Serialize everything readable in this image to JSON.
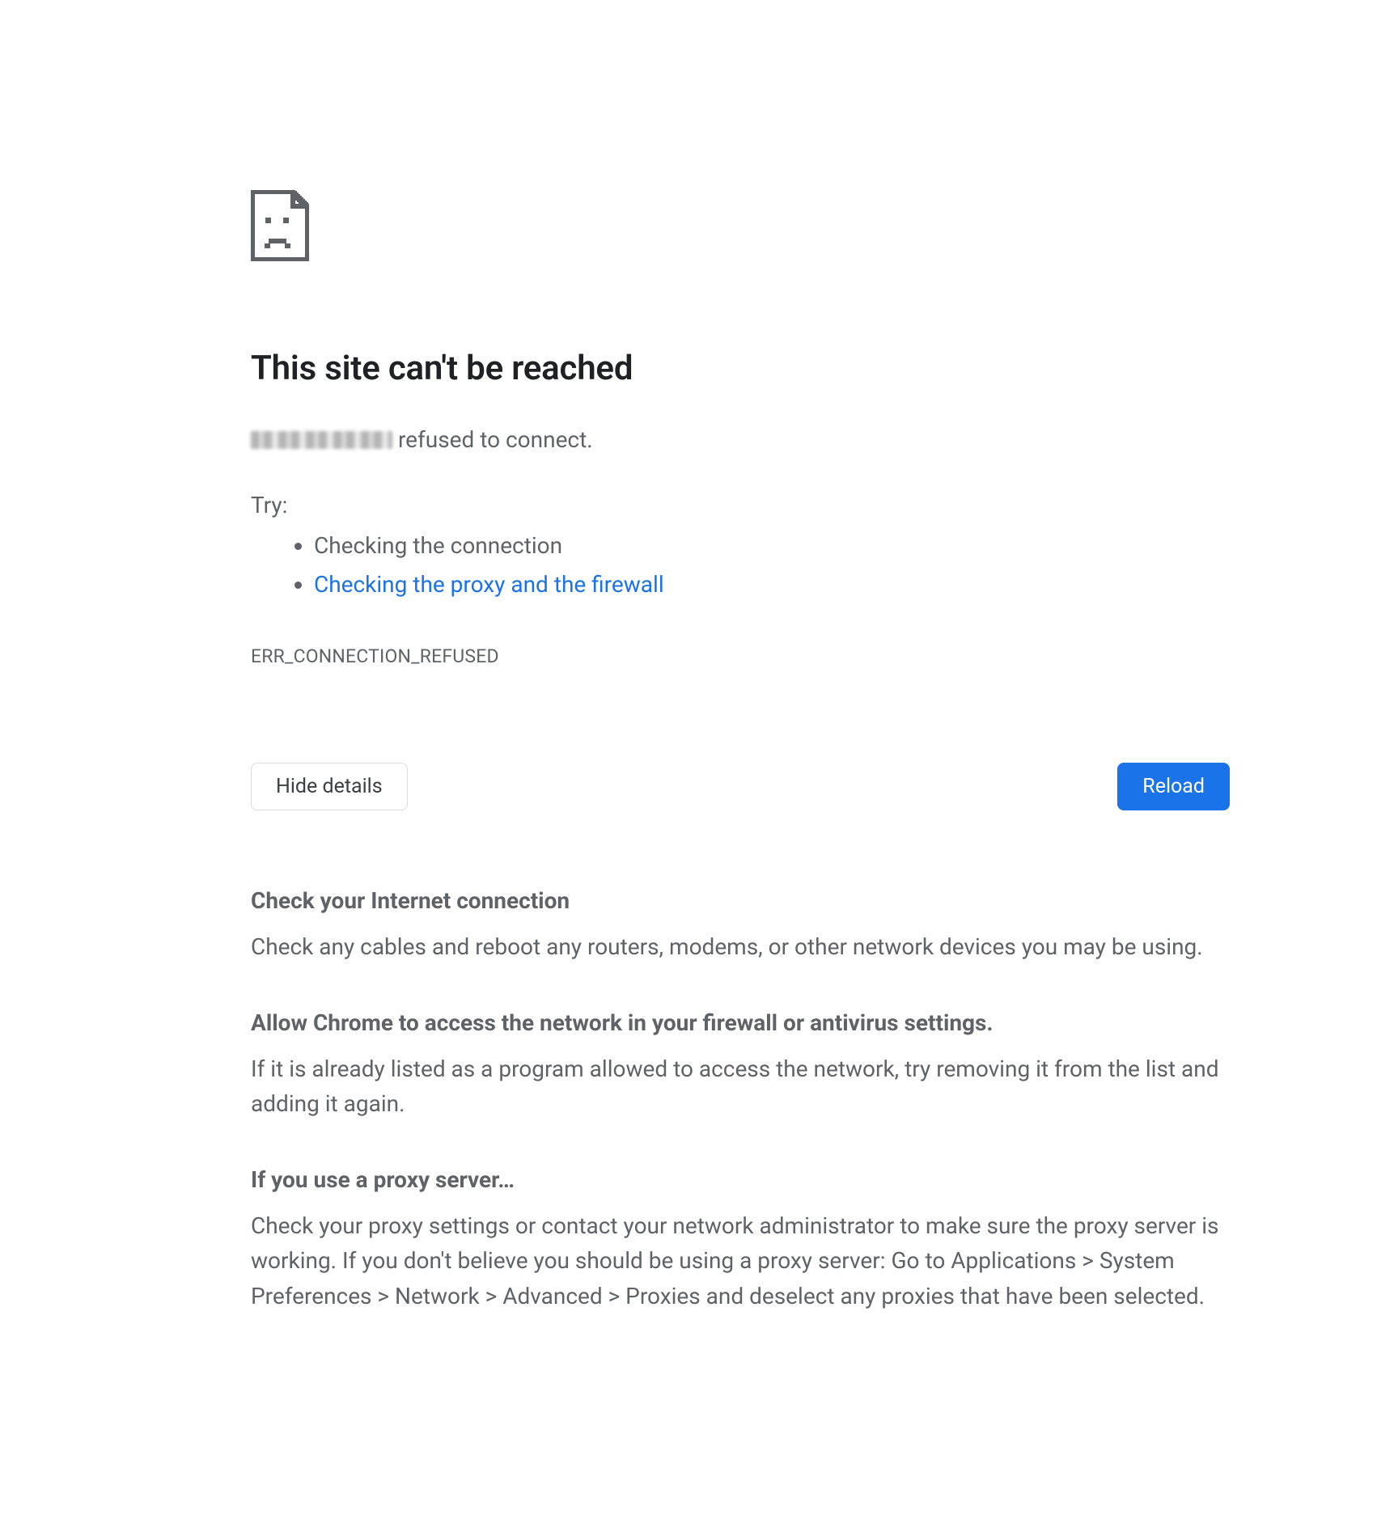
{
  "title": "This site can't be reached",
  "summary_suffix": " refused to connect.",
  "try_label": "Try:",
  "try_items": [
    {
      "text": "Checking the connection",
      "link": false
    },
    {
      "text": "Checking the proxy and the firewall",
      "link": true
    }
  ],
  "error_code": "ERR_CONNECTION_REFUSED",
  "buttons": {
    "hide_details": "Hide details",
    "reload": "Reload"
  },
  "details": [
    {
      "heading": "Check your Internet connection",
      "body": "Check any cables and reboot any routers, modems, or other network devices you may be using."
    },
    {
      "heading": "Allow Chrome to access the network in your firewall or antivirus settings.",
      "body": "If it is already listed as a program allowed to access the network, try removing it from the list and adding it again."
    },
    {
      "heading": "If you use a proxy server…",
      "body": "Check your proxy settings or contact your network administrator to make sure the proxy server is working. If you don't believe you should be using a proxy server: Go to Applications > System Preferences > Network > Advanced > Proxies and deselect any proxies that have been selected."
    }
  ]
}
